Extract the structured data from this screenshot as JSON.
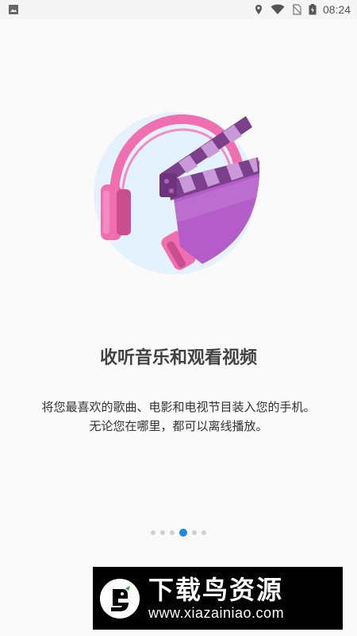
{
  "status_bar": {
    "time": "08:24",
    "icons": [
      "image-icon",
      "location-icon",
      "wifi-icon",
      "no-sim-icon",
      "battery-icon"
    ]
  },
  "onboarding": {
    "title": "收听音乐和观看视频",
    "description_line1": "将您最喜欢的歌曲、电影和电视节目装入您的手机。",
    "description_line2": "无论您在哪里，都可以离线播放。",
    "illustration": "headphones-clapperboard",
    "pager": {
      "total": 6,
      "current_index": 3
    }
  },
  "watermark": {
    "name": "下载鸟资源",
    "url": "www.xiazainiao.com"
  },
  "colors": {
    "accent": "#1e88e5",
    "headphone_pink": "#f06fb1",
    "clapper_purple": "#b45cc8",
    "circle_bg": "#e3f2fd"
  }
}
